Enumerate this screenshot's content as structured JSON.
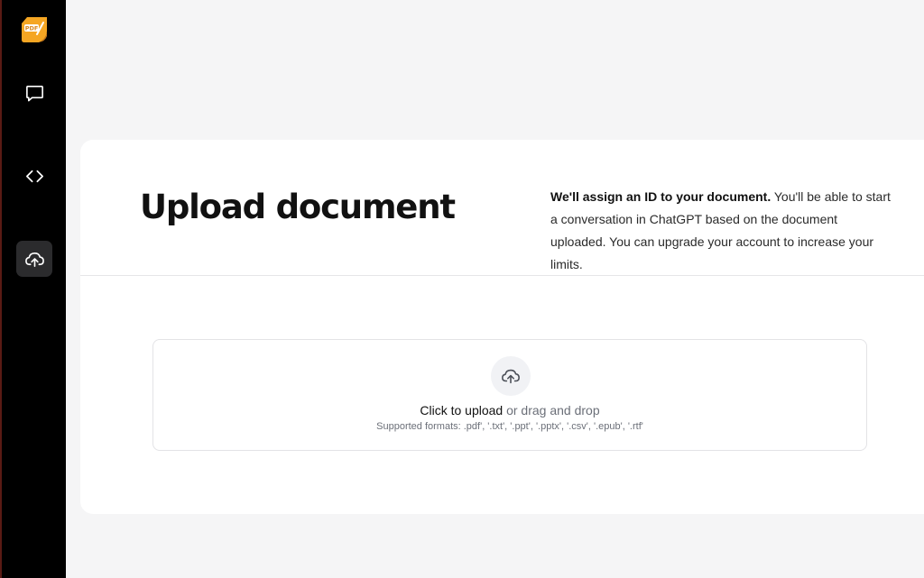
{
  "sidebar": {
    "logo_icon": "pdf-logo-icon",
    "logo_text": "PDF",
    "items": [
      {
        "icon": "chat-icon",
        "active": false
      },
      {
        "icon": "code-icon",
        "active": false
      },
      {
        "icon": "cloud-upload-icon",
        "active": true
      }
    ]
  },
  "header": {
    "title": "Upload document",
    "description_bold": "We'll assign an ID to your document.",
    "description_rest": " You'll be able to start a conversation in ChatGPT based on the document uploaded. You can upgrade your account to increase your limits."
  },
  "dropzone": {
    "icon": "upload-icon",
    "click_label": "Click to upload",
    "drag_label": " or drag and drop",
    "formats": "Supported formats: .pdf', '.txt', '.ppt', '.pptx', '.csv', '.epub', '.rtf'"
  },
  "colors": {
    "sidebar_bg": "#000000",
    "active_bg": "#2b2b2d",
    "page_bg": "#f5f5f6",
    "logo_accent": "#f5a623"
  }
}
